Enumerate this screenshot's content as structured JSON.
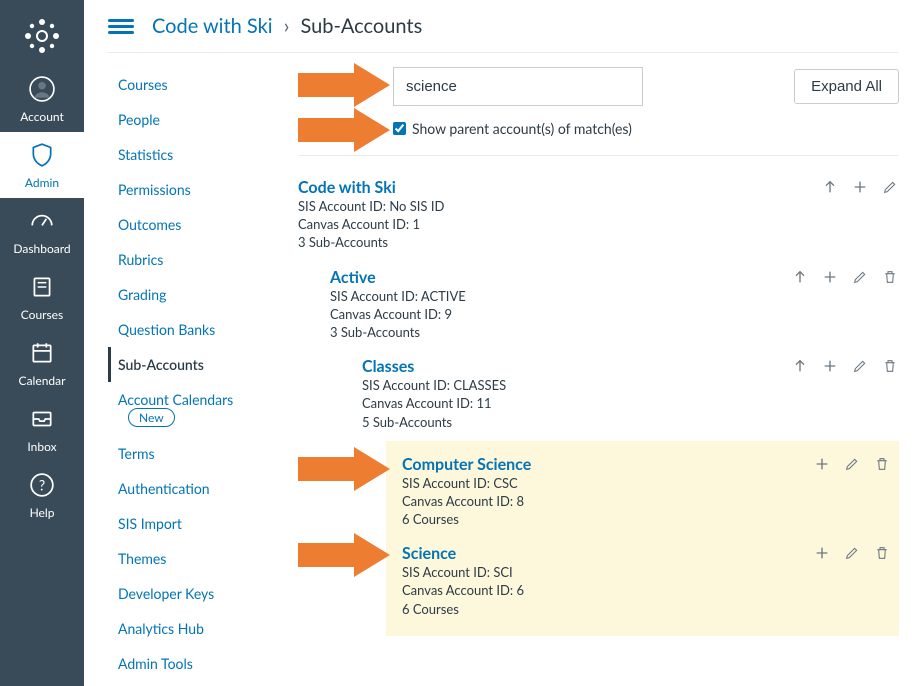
{
  "globalNav": {
    "items": [
      {
        "id": "account",
        "label": "Account"
      },
      {
        "id": "admin",
        "label": "Admin"
      },
      {
        "id": "dashboard",
        "label": "Dashboard"
      },
      {
        "id": "courses",
        "label": "Courses"
      },
      {
        "id": "calendar",
        "label": "Calendar"
      },
      {
        "id": "inbox",
        "label": "Inbox"
      },
      {
        "id": "help",
        "label": "Help"
      }
    ],
    "active": "admin"
  },
  "breadcrumb": {
    "root": "Code with Ski",
    "current": "Sub-Accounts"
  },
  "accountNav": {
    "items": [
      {
        "label": "Courses"
      },
      {
        "label": "People"
      },
      {
        "label": "Statistics"
      },
      {
        "label": "Permissions"
      },
      {
        "label": "Outcomes"
      },
      {
        "label": "Rubrics"
      },
      {
        "label": "Grading"
      },
      {
        "label": "Question Banks"
      },
      {
        "label": "Sub-Accounts",
        "active": true
      },
      {
        "label": "Account Calendars",
        "badge": "New"
      },
      {
        "label": "Terms"
      },
      {
        "label": "Authentication"
      },
      {
        "label": "SIS Import"
      },
      {
        "label": "Themes"
      },
      {
        "label": "Developer Keys"
      },
      {
        "label": "Analytics Hub"
      },
      {
        "label": "Admin Tools"
      }
    ]
  },
  "search": {
    "value": "science",
    "checkboxLabel": "Show parent account(s) of match(es)",
    "checked": true,
    "expandLabel": "Expand All"
  },
  "tree": {
    "root": {
      "title": "Code with Ski",
      "sisId": "SIS Account ID: No SIS ID",
      "canvasId": "Canvas Account ID: 1",
      "subCount": "3 Sub-Accounts"
    },
    "active": {
      "title": "Active",
      "sisId": "SIS Account ID: ACTIVE",
      "canvasId": "Canvas Account ID: 9",
      "subCount": "3 Sub-Accounts"
    },
    "classes": {
      "title": "Classes",
      "sisId": "SIS Account ID: CLASSES",
      "canvasId": "Canvas Account ID: 11",
      "subCount": "5 Sub-Accounts"
    },
    "compsci": {
      "title": "Computer Science",
      "sisId": "SIS Account ID: CSC",
      "canvasId": "Canvas Account ID: 8",
      "courseCount": "6 Courses"
    },
    "science": {
      "title": "Science",
      "sisId": "SIS Account ID: SCI",
      "canvasId": "Canvas Account ID: 6",
      "courseCount": "6 Courses"
    }
  },
  "colors": {
    "link": "#0374b5",
    "nav": "#394b58",
    "arrow": "#ed7d31",
    "highlight": "#fdf7dc"
  }
}
